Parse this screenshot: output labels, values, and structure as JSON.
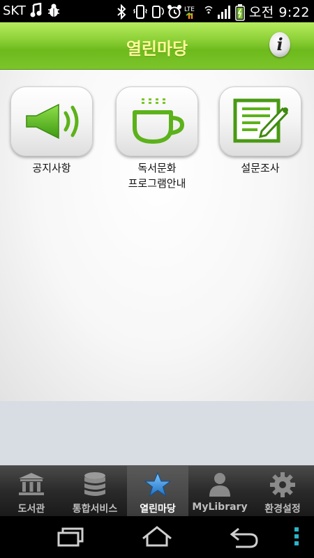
{
  "status_bar": {
    "carrier": "SKT",
    "ampm": "오전",
    "time": "9:22",
    "icons": [
      "music-note-icon",
      "bug-icon",
      "bluetooth-icon",
      "vibrate-icon",
      "rotate-icon",
      "alarm-icon",
      "lte-icon",
      "wifi-icon",
      "signal-icon",
      "battery-icon"
    ],
    "lte_label": "LTE"
  },
  "header": {
    "title": "열린마당",
    "info_label": "i"
  },
  "tiles": [
    {
      "label": "공지사항",
      "icon": "speaker-icon"
    },
    {
      "label": "독서문화\n프로그램안내",
      "icon": "coffee-cup-icon"
    },
    {
      "label": "설문조사",
      "icon": "survey-pen-icon"
    }
  ],
  "tabbar": {
    "tabs": [
      {
        "label": "도서관",
        "icon": "library-building-icon",
        "active": false
      },
      {
        "label": "통합서비스",
        "icon": "database-icon",
        "active": false
      },
      {
        "label": "열린마당",
        "icon": "star-icon",
        "active": true
      },
      {
        "label": "MyLibrary",
        "icon": "person-icon",
        "active": false
      },
      {
        "label": "환경설정",
        "icon": "gear-icon",
        "active": false
      }
    ]
  },
  "navbar": {
    "buttons": [
      "recent-apps-icon",
      "home-icon",
      "back-icon",
      "menu-icon"
    ]
  },
  "colors": {
    "header_green": "#7cc52a",
    "header_title": "#fffb9a",
    "icon_green": "#5cb21a",
    "active_star": "#2f8fd8",
    "menu_accent": "#2bb5c8"
  }
}
